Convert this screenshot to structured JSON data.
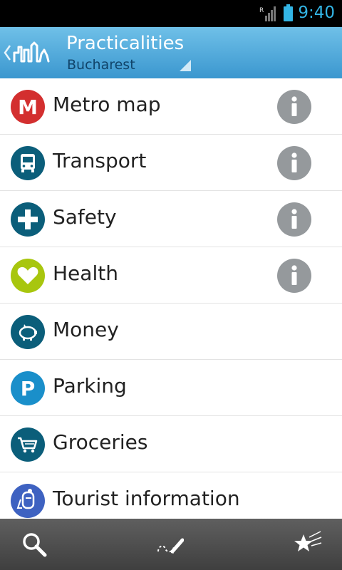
{
  "status_bar": {
    "time": "9:40",
    "roaming_indicator": "R",
    "icons": [
      "signal-icon",
      "battery-icon"
    ],
    "accent_color": "#33b5e5"
  },
  "header": {
    "title": "Practicalities",
    "subtitle": "Bucharest",
    "icons": [
      "back-chevron-icon",
      "city-skyline-logo",
      "dropdown-triangle-icon"
    ]
  },
  "list": {
    "items": [
      {
        "label": "Metro map",
        "icon": "metro-icon",
        "icon_text": "M",
        "color": "#d32f2f",
        "info": true
      },
      {
        "label": "Transport",
        "icon": "bus-icon",
        "color": "#0b5e7a",
        "info": true
      },
      {
        "label": "Safety",
        "icon": "cross-icon",
        "color": "#0b5e7a",
        "info": true
      },
      {
        "label": "Health",
        "icon": "heart-icon",
        "color": "#a8c60e",
        "info": true
      },
      {
        "label": "Money",
        "icon": "piggy-bank-icon",
        "color": "#0b5e7a",
        "info": false
      },
      {
        "label": "Parking",
        "icon": "parking-icon",
        "icon_text": "P",
        "color": "#1a8fca",
        "info": false
      },
      {
        "label": "Groceries",
        "icon": "shopping-cart-icon",
        "color": "#0b5e7a",
        "info": false
      },
      {
        "label": "Tourist information",
        "icon": "tourist-info-icon",
        "color": "#3e62c1",
        "info": false
      }
    ],
    "info_icon": "info-icon",
    "info_color": "#95999c"
  },
  "bottom_bar": {
    "buttons": [
      "search-icon",
      "edit-route-icon",
      "favorites-star-icon"
    ]
  }
}
